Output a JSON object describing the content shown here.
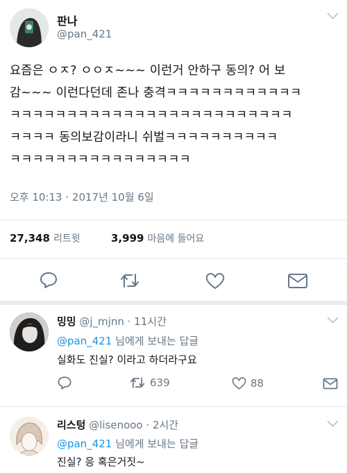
{
  "tweet": {
    "author_name": "판나",
    "author_handle": "@pan_421",
    "text_lines": [
      "요즘은 ㅇㅈ? ㅇㅇㅈ~~~ 이런거 안하구 동의? 어 보",
      "감~~~ 이런다던데 존나 충격ㅋㅋㅋㅋㅋㅋㅋㅋㅋㅋㅋㅋ",
      "ㅋㅋㅋㅋㅋㅋㅋㅋㅋㅋㅋㅋㅋㅋㅋㅋㅋㅋㅋㅋㅋㅋㅋㅋㅋ",
      "ㅋㅋㅋㅋ 동의보감이라니 쉬벌ㅋㅋㅋㅋㅋㅋㅋㅋㅋㅋ",
      "ㅋㅋㅋㅋㅋㅋㅋㅋㅋㅋㅋㅋㅋㅋㅋㅋ"
    ],
    "timestamp": "오후 10:13 · 2017년 10월 6일",
    "retweets_count": "27,348",
    "retweets_label": "리트윗",
    "likes_count": "3,999",
    "likes_label": "마음에 들어요"
  },
  "replies": [
    {
      "name": "밍밍",
      "handle": "@j_mjnn",
      "time": "· 11시간",
      "replying_to": "@pan_421",
      "replying_suffix": "님에게 보내는 답글",
      "text": "실화도 진실? 이라고 하더라구요",
      "retweets": "639",
      "likes": "88"
    },
    {
      "name": "리스텅",
      "handle": "@lisenooo",
      "time": "· 2시간",
      "replying_to": "@pan_421",
      "replying_suffix": "님에게 보내는 답글",
      "text": "진실? 응 혹은거짓~"
    }
  ],
  "icons": {
    "reply": "speech-bubble-icon",
    "retweet": "retweet-arrows-icon",
    "like": "heart-icon",
    "dm": "envelope-icon",
    "more": "chevron-down-icon"
  },
  "colors": {
    "text": "#14171a",
    "muted": "#657786",
    "link": "#1b95e0",
    "divider": "#e1e8ed"
  }
}
